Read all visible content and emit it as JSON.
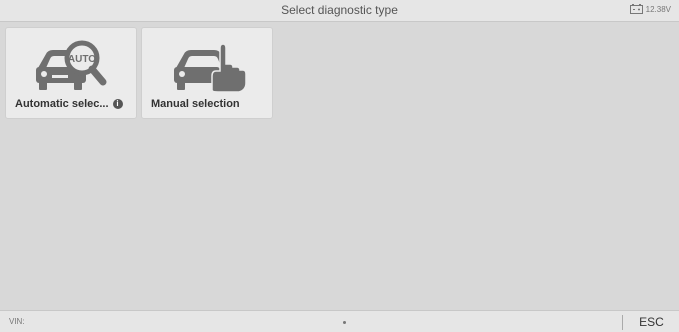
{
  "header": {
    "title": "Select diagnostic type",
    "voltage": "12.38V",
    "battery_icon": "battery-icon"
  },
  "tiles": [
    {
      "label": "Automatic selec...",
      "icon": "car-magnifier-auto-icon",
      "badge": "i",
      "badge_icon": "info-icon",
      "auto_text": "AUTO"
    },
    {
      "label": "Manual selection",
      "icon": "car-hand-icon"
    }
  ],
  "footer": {
    "vin_label": "VIN:",
    "esc_label": "ESC"
  },
  "colors": {
    "background": "#d8d8d8",
    "bar": "#e6e6e6",
    "tile": "#ebebeb",
    "icon": "#6f6f6f"
  }
}
